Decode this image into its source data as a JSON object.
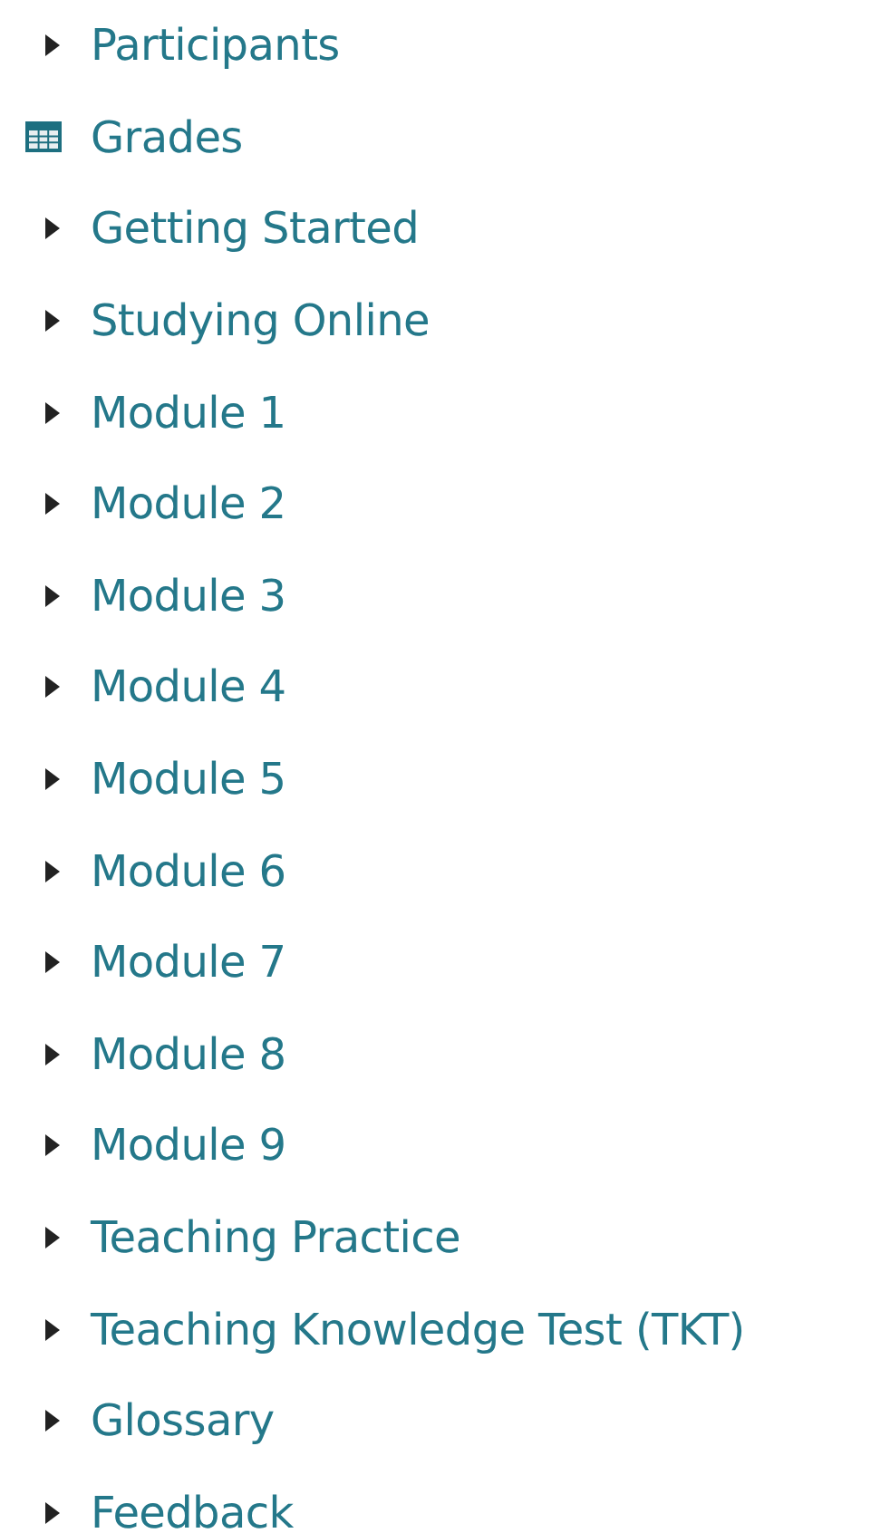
{
  "items": [
    {
      "kind": "branch",
      "label": "Participants",
      "expanded": false
    },
    {
      "kind": "grades",
      "label": "Grades"
    },
    {
      "kind": "branch",
      "label": "Getting Started",
      "expanded": false
    },
    {
      "kind": "branch",
      "label": "Studying Online",
      "expanded": false
    },
    {
      "kind": "branch",
      "label": "Module 1",
      "expanded": false
    },
    {
      "kind": "branch",
      "label": "Module 2",
      "expanded": false
    },
    {
      "kind": "branch",
      "label": "Module 3",
      "expanded": false
    },
    {
      "kind": "branch",
      "label": "Module 4",
      "expanded": false
    },
    {
      "kind": "branch",
      "label": "Module 5",
      "expanded": false
    },
    {
      "kind": "branch",
      "label": "Module 6",
      "expanded": false
    },
    {
      "kind": "branch",
      "label": "Module 7",
      "expanded": false
    },
    {
      "kind": "branch",
      "label": "Module 8",
      "expanded": false
    },
    {
      "kind": "branch",
      "label": "Module 9",
      "expanded": false
    },
    {
      "kind": "branch",
      "label": "Teaching Practice",
      "expanded": false
    },
    {
      "kind": "branch",
      "label": "Teaching Knowledge Test (TKT)",
      "expanded": false
    },
    {
      "kind": "branch",
      "label": "Glossary",
      "expanded": false
    },
    {
      "kind": "branch",
      "label": "Feedback",
      "expanded": false
    }
  ]
}
